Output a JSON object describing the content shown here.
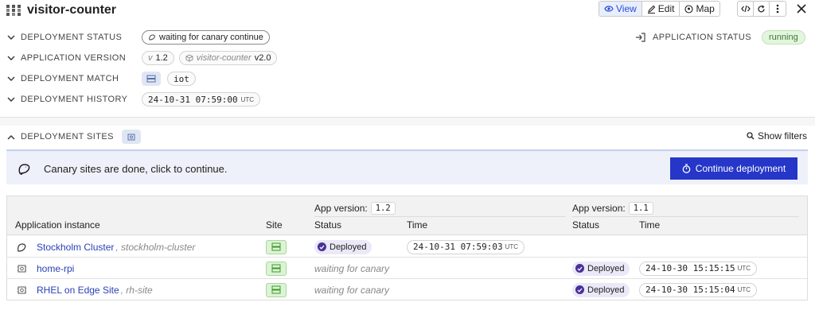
{
  "header": {
    "title": "visitor-counter",
    "tabs": [
      {
        "label": "View",
        "icon": "eye-icon",
        "active": true
      },
      {
        "label": "Edit",
        "icon": "pencil-icon",
        "active": false
      },
      {
        "label": "Map",
        "icon": "map-pin-icon",
        "active": false
      }
    ],
    "actions": [
      {
        "icon": "code-icon"
      },
      {
        "icon": "refresh-icon"
      },
      {
        "icon": "more-vertical-icon"
      }
    ],
    "close_icon": "close-icon"
  },
  "properties": {
    "deployment_status": {
      "label": "DEPLOYMENT STATUS",
      "value": "waiting for canary continue"
    },
    "application_version": {
      "label": "APPLICATION VERSION",
      "version_prefix": "v",
      "version": "1.2",
      "app_name": "visitor-counter",
      "app_version": "v2.0"
    },
    "deployment_match": {
      "label": "DEPLOYMENT MATCH",
      "tag": "iot"
    },
    "deployment_history": {
      "label": "DEPLOYMENT HISTORY",
      "timestamp": "24-10-31 07:59:00",
      "tz": "UTC"
    },
    "application_status": {
      "label": "APPLICATION STATUS",
      "value": "running"
    }
  },
  "sites": {
    "label": "DEPLOYMENT SITES",
    "show_filters": "Show filters"
  },
  "banner": {
    "message": "Canary sites are done, click to continue.",
    "button_label": "Continue deployment"
  },
  "table": {
    "col_instance": "Application instance",
    "col_site": "Site",
    "versions": [
      {
        "label": "App version:",
        "version": "1.2",
        "col_status": "Status",
        "col_time": "Time"
      },
      {
        "label": "App version:",
        "version": "1.1",
        "col_status": "Status",
        "col_time": "Time"
      }
    ],
    "rows": [
      {
        "name": "Stockholm Cluster",
        "slug": "stockholm-cluster",
        "icon": "canary-bird-icon",
        "v12_status": "Deployed",
        "v12_time": "24-10-31 07:59:03",
        "v12_tz": "UTC",
        "v11_status": "",
        "v11_time": "",
        "v11_tz": ""
      },
      {
        "name": "home-rpi",
        "slug": "",
        "icon": "device-icon",
        "v12_status": "waiting for canary",
        "v12_time": "",
        "v12_tz": "",
        "v11_status": "Deployed",
        "v11_time": "24-10-30 15:15:15",
        "v11_tz": "UTC"
      },
      {
        "name": "RHEL on Edge Site",
        "slug": "rh-site",
        "icon": "device-icon",
        "v12_status": "waiting for canary",
        "v12_time": "",
        "v12_tz": "",
        "v11_status": "Deployed",
        "v11_time": "24-10-30 15:15:04",
        "v11_tz": "UTC"
      }
    ]
  },
  "colors": {
    "primary": "#2536c8",
    "link": "#2a41b8",
    "running_bg": "#e3f5df",
    "deployed_dot": "#4a2f9a"
  }
}
